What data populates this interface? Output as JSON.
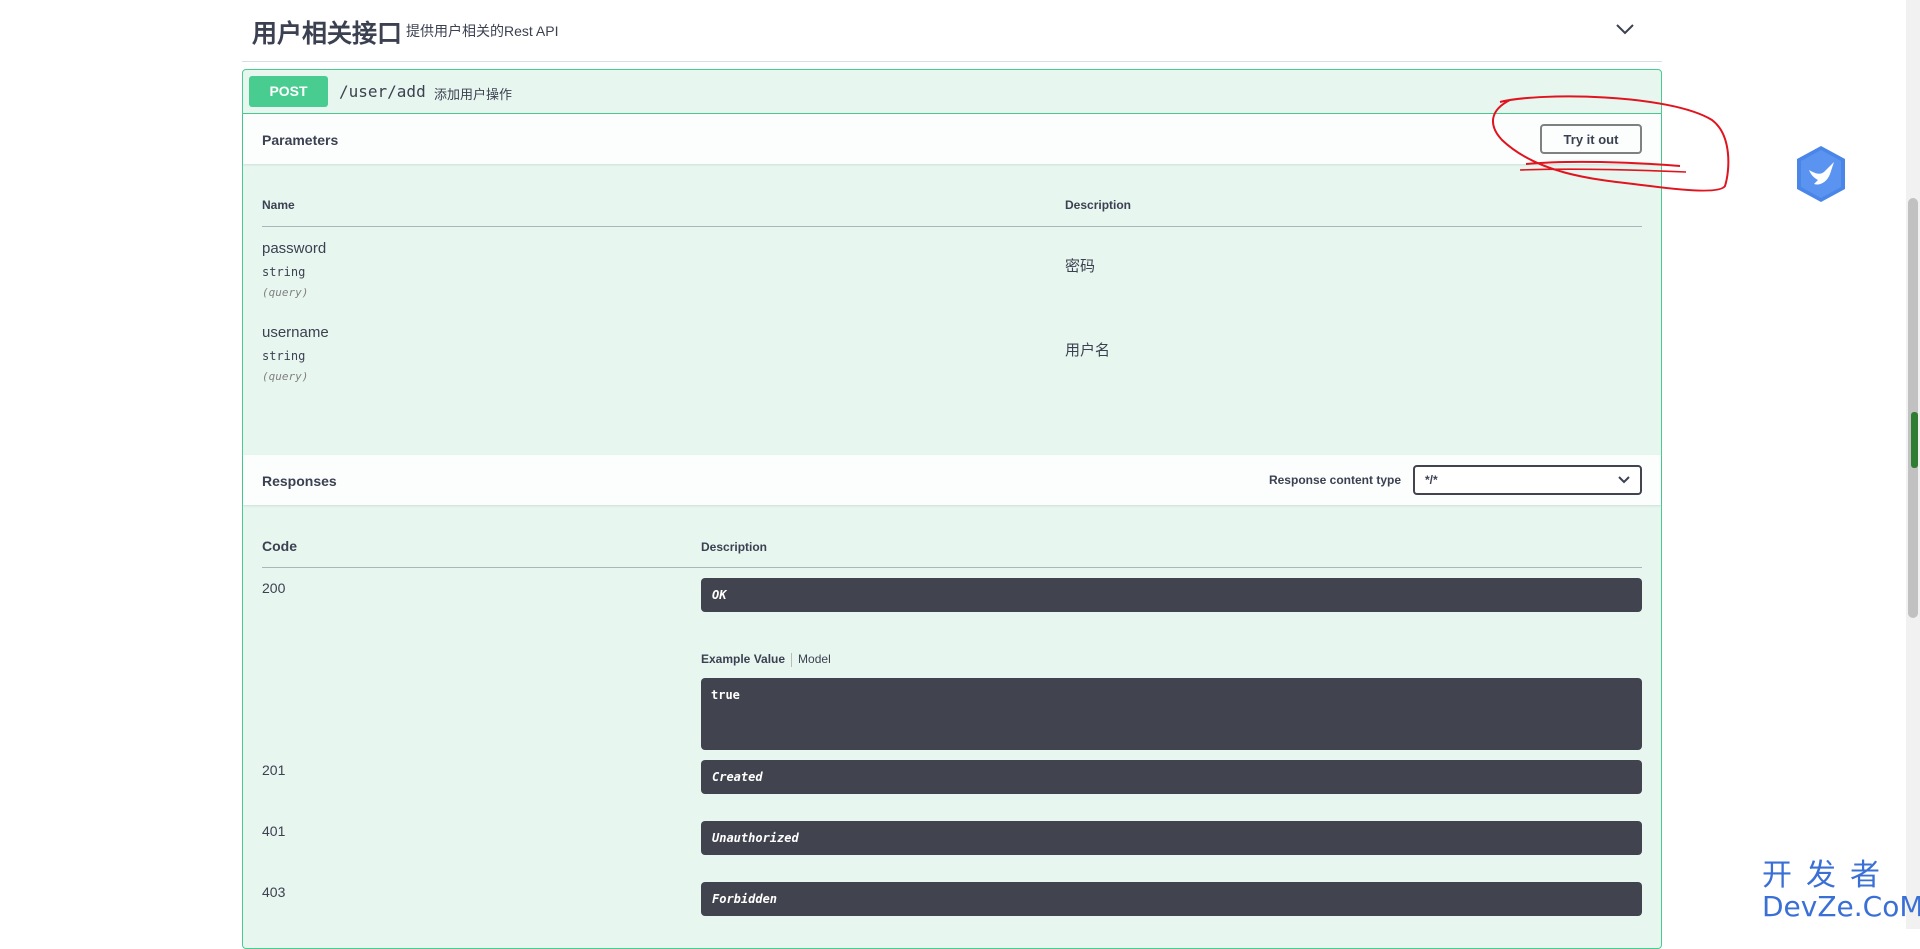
{
  "tag": {
    "title": "用户相关接口",
    "description": "提供用户相关的Rest API"
  },
  "operation": {
    "method": "POST",
    "path": "/user/add",
    "summary": "添加用户操作"
  },
  "parameters": {
    "title": "Parameters",
    "try_it_out": "Try it out",
    "col_name": "Name",
    "col_description": "Description",
    "items": [
      {
        "name": "password",
        "type": "string",
        "in": "(query)",
        "description": "密码"
      },
      {
        "name": "username",
        "type": "string",
        "in": "(query)",
        "description": "用户名"
      }
    ]
  },
  "responses": {
    "title": "Responses",
    "content_type_label": "Response content type",
    "content_type_value": "*/*",
    "col_code": "Code",
    "col_description": "Description",
    "example_value_tab": "Example Value",
    "model_tab": "Model",
    "example_body": "true",
    "items": [
      {
        "code": "200",
        "description": "OK"
      },
      {
        "code": "201",
        "description": "Created"
      },
      {
        "code": "401",
        "description": "Unauthorized"
      },
      {
        "code": "403",
        "description": "Forbidden"
      }
    ]
  },
  "watermark": {
    "cn": "开发者",
    "en": "DevZe.CoM"
  },
  "colors": {
    "post_green": "#49cc90",
    "block_bg": "#e8f6f0",
    "dark_box": "#41444e",
    "annotation_red": "#e0141e"
  }
}
